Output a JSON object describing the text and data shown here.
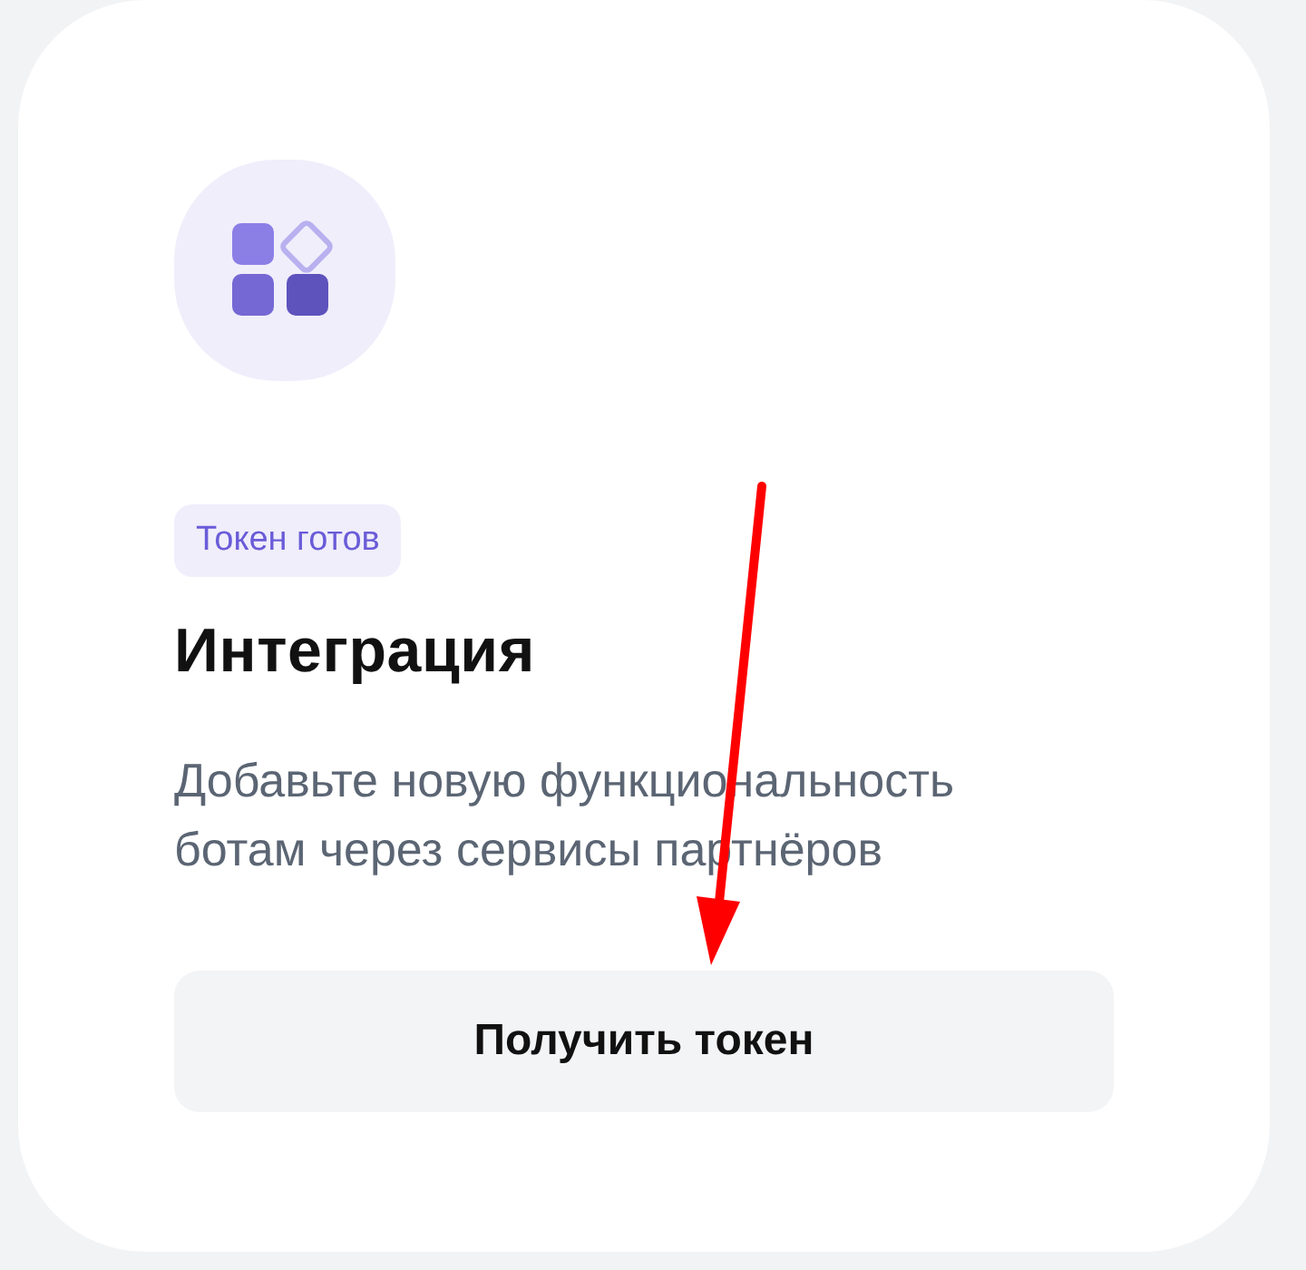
{
  "card": {
    "badge": "Токен готов",
    "title": "Интеграция",
    "description": "Добавьте новую функциональность ботам через сервисы партнёров",
    "button": "Получить токен"
  }
}
